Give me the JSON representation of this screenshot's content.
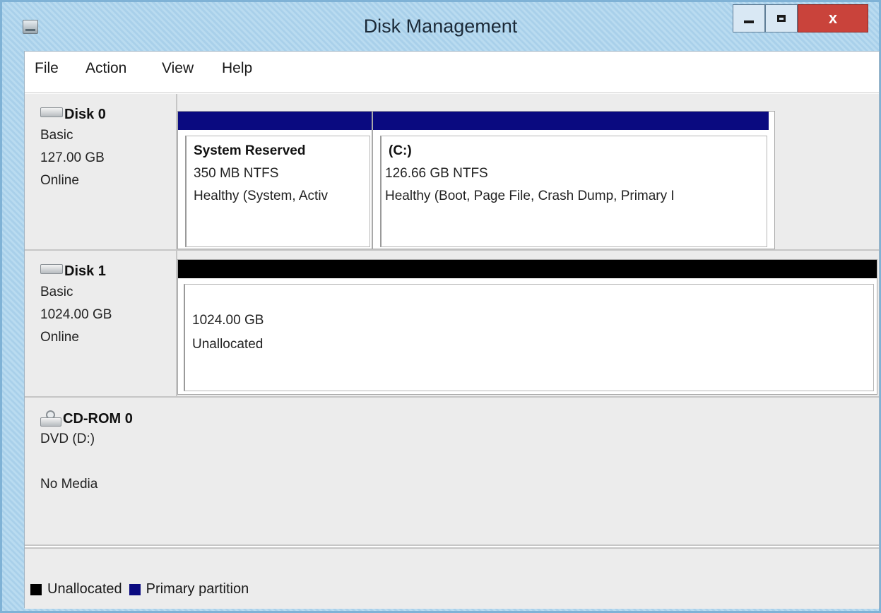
{
  "window": {
    "title": "Disk Management",
    "minimize_glyph": "–",
    "close_glyph": "x"
  },
  "menu": {
    "file": "File",
    "action": "Action",
    "view": "View",
    "help": "Help"
  },
  "disks": [
    {
      "name": "Disk 0",
      "type": "Basic",
      "size": "127.00 GB",
      "status": "Online",
      "volumes": [
        {
          "title": "System Reserved",
          "size": "350 MB NTFS",
          "health": "Healthy (System, Activ",
          "bar": "primary"
        },
        {
          "title": "(C:)",
          "size": "126.66 GB NTFS",
          "health": "Healthy (Boot, Page File, Crash Dump, Primary I",
          "bar": "primary"
        }
      ]
    },
    {
      "name": "Disk 1",
      "type": "Basic",
      "size": "1024.00 GB",
      "status": "Online",
      "volumes": [
        {
          "size": "1024.00 GB",
          "health": "Unallocated",
          "bar": "unallocated"
        }
      ]
    },
    {
      "name": "CD-ROM 0",
      "type": "DVD (D:)",
      "status": "No Media"
    }
  ],
  "legend": {
    "unallocated": "Unallocated",
    "primary": "Primary partition"
  },
  "colors": {
    "primary_partition": "#0a0a80",
    "unallocated": "#000000",
    "close_button": "#c9433b"
  }
}
